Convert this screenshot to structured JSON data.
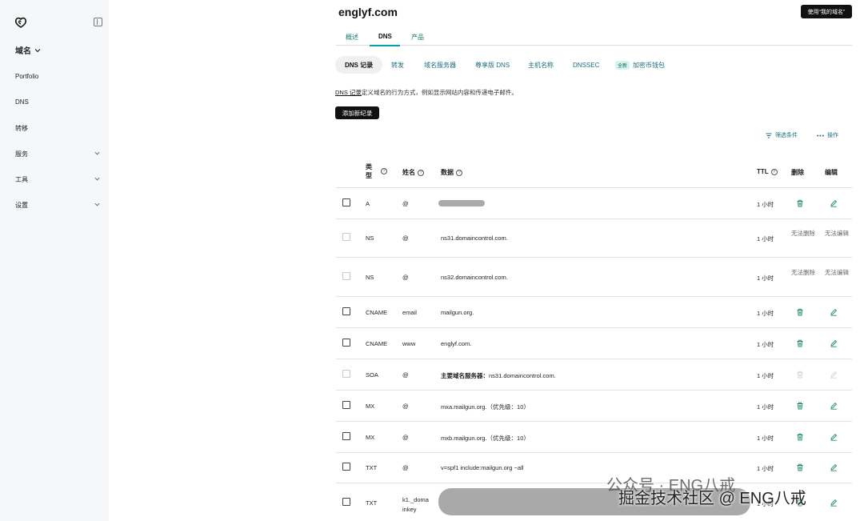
{
  "sidebar": {
    "main_label": "域名",
    "items": [
      {
        "label": "Portfolio",
        "has_chevron": false
      },
      {
        "label": "DNS",
        "has_chevron": false
      },
      {
        "label": "转移",
        "has_chevron": false
      },
      {
        "label": "服务",
        "has_chevron": true
      },
      {
        "label": "工具",
        "has_chevron": true
      },
      {
        "label": "设置",
        "has_chevron": true
      }
    ]
  },
  "header": {
    "domain": "englyf.com",
    "use_button": "使用“我的域名”",
    "tabs": [
      "概述",
      "DNS",
      "产品"
    ]
  },
  "subtabs": {
    "items": [
      "DNS 记录",
      "转发",
      "域名服务器",
      "尊享版 DNS",
      "主机名称",
      "DNSSEC",
      "加密币钱包"
    ],
    "badge": "全新"
  },
  "description": {
    "link": "DNS 记录",
    "text": "定义域名的行为方式，例如显示网站内容和传递电子邮件。"
  },
  "add_record_button": "添加新纪录",
  "filter_label": "筛选条件",
  "ops_label": "操作",
  "table": {
    "headers": {
      "type": "类型",
      "name": "姓名",
      "data": "数据",
      "ttl": "TTL",
      "delete": "删除",
      "edit": "编辑"
    },
    "cannot_delete": "无法删除",
    "cannot_edit": "无法编辑",
    "rows": [
      {
        "type": "A",
        "name": "@",
        "data": "",
        "ttl": "1 小时",
        "editable": true,
        "checkbox": true
      },
      {
        "type": "NS",
        "name": "@",
        "data": "ns31.domaincontrol.com.",
        "ttl": "1 小时",
        "editable": false,
        "checkbox": false
      },
      {
        "type": "NS",
        "name": "@",
        "data": "ns32.domaincontrol.com.",
        "ttl": "1 小时",
        "editable": false,
        "checkbox": false
      },
      {
        "type": "CNAME",
        "name": "email",
        "data": "mailgun.org.",
        "ttl": "1 小时",
        "editable": true,
        "checkbox": true
      },
      {
        "type": "CNAME",
        "name": "www",
        "data": "englyf.com.",
        "ttl": "1 小时",
        "editable": true,
        "checkbox": true
      },
      {
        "type": "SOA",
        "name": "@",
        "data_label": "主要域名服务器：",
        "data": "ns31.domaincontrol.com.",
        "ttl": "1 小时",
        "editable": "disabled",
        "checkbox": false
      },
      {
        "type": "MX",
        "name": "@",
        "data": "mxa.mailgun.org.（优先级：10）",
        "ttl": "1 小时",
        "editable": true,
        "checkbox": true
      },
      {
        "type": "MX",
        "name": "@",
        "data": "mxb.mailgun.org.（优先级：10）",
        "ttl": "1 小时",
        "editable": true,
        "checkbox": true
      },
      {
        "type": "TXT",
        "name": "@",
        "data": "v=spf1 include:mailgun.org ~all",
        "ttl": "1 小时",
        "editable": true,
        "checkbox": true
      },
      {
        "type": "TXT",
        "name": "k1._domainkey",
        "data": "",
        "ttl": "1 小时",
        "editable": true,
        "checkbox": true
      }
    ]
  },
  "watermark": {
    "line1": "公众号 · ENG八戒",
    "line2": "掘金技术社区 @ ENG八戒"
  },
  "colors": {
    "accent": "#00a4a6",
    "link": "#1a6f7f",
    "sidebar_bg": "#f5f7f8"
  }
}
